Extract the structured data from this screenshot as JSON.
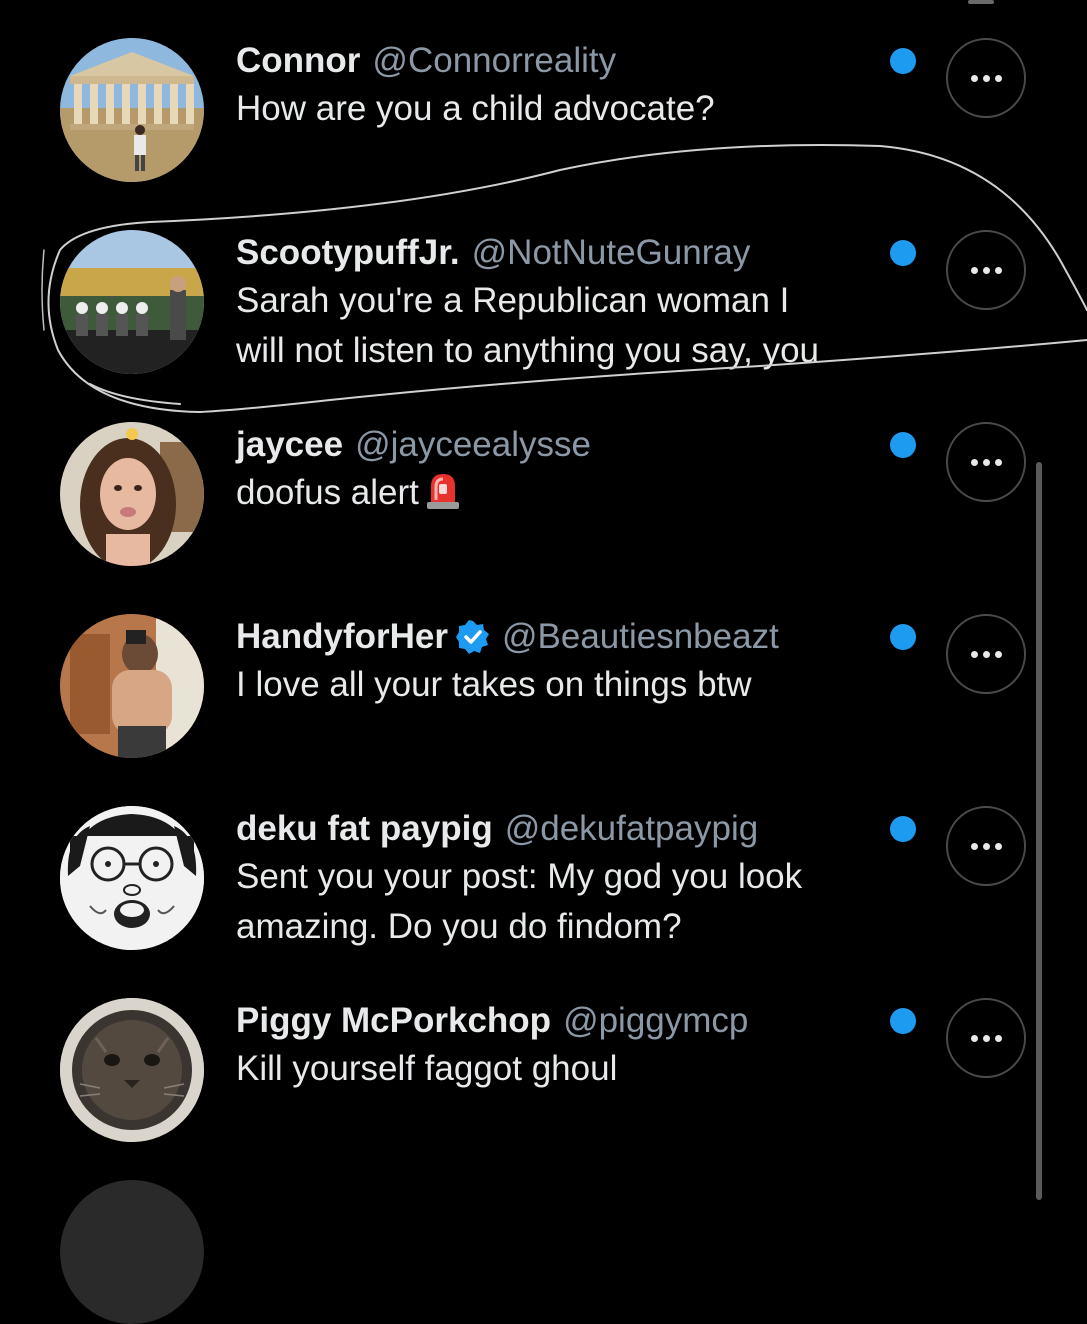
{
  "colors": {
    "background": "#000000",
    "text_primary": "#e7e9ea",
    "text_secondary": "#8b98a5",
    "unread_dot": "#1d9bf0",
    "verified_badge": "#1d9bf0",
    "scribble": "#d0d0d0"
  },
  "replies": [
    {
      "display_name": "Connor",
      "handle": "@Connorreality",
      "verified": false,
      "text": "How are you a child advocate?",
      "unread": true,
      "avatar_icon": "avatar-photo-building"
    },
    {
      "display_name": "ScootypuffJr.",
      "handle": "@NotNuteGunray",
      "verified": false,
      "text": "Sarah you're a Republican woman I\nwill not listen to anything you say, you",
      "unread": true,
      "avatar_icon": "avatar-photo-stadium",
      "circled": true
    },
    {
      "display_name": "jaycee",
      "handle": "@jayceealysse",
      "verified": false,
      "text": "doofus alert",
      "emoji_icon": "siren-emoji",
      "unread": true,
      "avatar_icon": "avatar-photo-woman"
    },
    {
      "display_name": "HandyforHer",
      "handle": "@Beautiesnbeazt",
      "verified": true,
      "text": "I love all your takes on things btw",
      "unread": true,
      "avatar_icon": "avatar-photo-selfie"
    },
    {
      "display_name": "deku fat paypig",
      "handle": "@dekufatpaypig",
      "verified": false,
      "text": "Sent you your post: My god you look\namazing. Do you do findom?",
      "unread": true,
      "avatar_icon": "avatar-cartoon-face"
    },
    {
      "display_name": "Piggy McPorkchop",
      "handle": "@piggymcp",
      "verified": false,
      "text": "Kill yourself faggot ghoul",
      "unread": true,
      "avatar_icon": "avatar-photo-cat"
    }
  ],
  "more_button_icon": "more-horizontal-icon",
  "unread_icon": "unread-dot-icon"
}
